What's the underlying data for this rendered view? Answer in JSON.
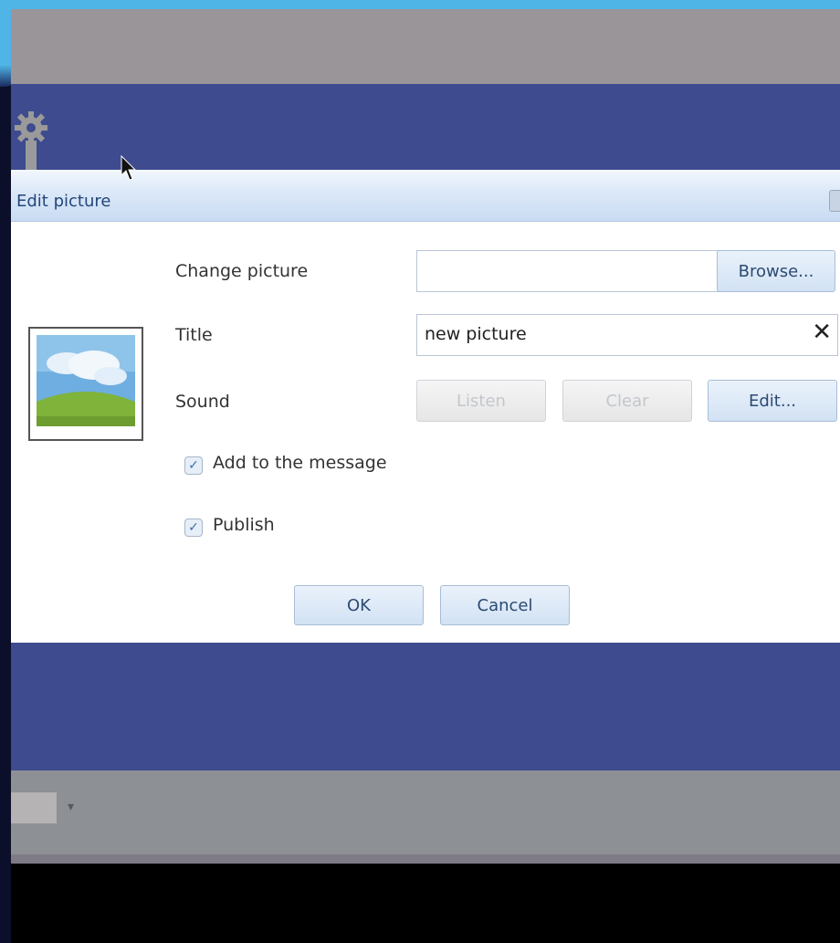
{
  "dialog": {
    "title": "Edit picture",
    "change_picture": {
      "label": "Change picture",
      "value": "",
      "browse_button": "Browse..."
    },
    "title_field": {
      "label": "Title",
      "value": "new picture",
      "clear_icon": "✕"
    },
    "sound": {
      "label": "Sound",
      "listen_button": "Listen",
      "clear_button": "Clear",
      "edit_button": "Edit..."
    },
    "options": {
      "add_to_message": {
        "label": "Add to the message",
        "checked": true
      },
      "publish": {
        "label": "Publish",
        "checked": true
      }
    },
    "ok_button": "OK",
    "cancel_button": "Cancel"
  },
  "icons": {
    "gear": "gear-icon",
    "cursor": "mouse-cursor-icon",
    "picture": "picture-placeholder-icon",
    "dropdown": "chevron-down-icon",
    "check": "✓",
    "dropdown_glyph": "▾"
  },
  "colors": {
    "header_band": "#3e4b8f",
    "titlebar": "#dbe8f8",
    "frame_accent": "#4fb4e6"
  }
}
